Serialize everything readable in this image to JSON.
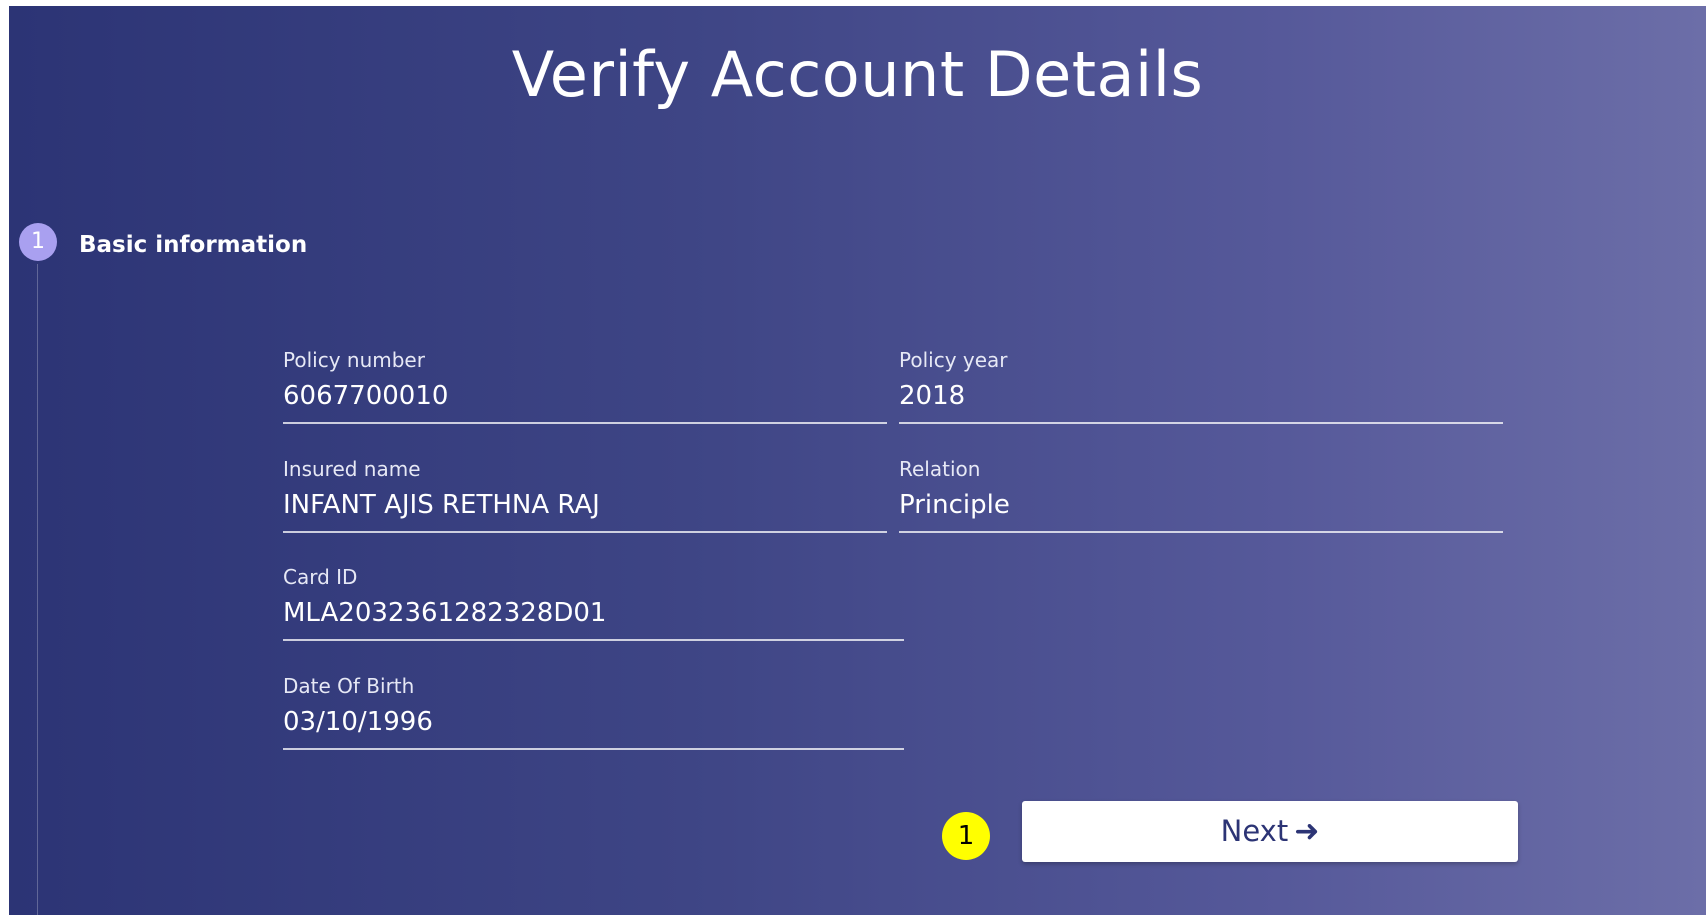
{
  "page": {
    "title": "Verify Account Details"
  },
  "steps": [
    {
      "number": "1",
      "label": "Basic information"
    }
  ],
  "fields": {
    "policy_number": {
      "label": "Policy number",
      "value": "6067700010"
    },
    "policy_year": {
      "label": "Policy year",
      "value": "2018"
    },
    "insured_name": {
      "label": "Insured name",
      "value": "INFANT AJIS RETHNA RAJ"
    },
    "relation": {
      "label": "Relation",
      "value": "Principle"
    },
    "card_id": {
      "label": "Card ID",
      "value": "MLA2032361282328D01"
    },
    "date_of_birth": {
      "label": "Date Of Birth",
      "value": "03/10/1996"
    }
  },
  "annotation": {
    "marker": "1"
  },
  "actions": {
    "next_label": "Next",
    "next_icon": "arrow-right-icon"
  },
  "colors": {
    "background_start": "#2c3475",
    "background_end": "#6c6ea8",
    "step_circle": "#a9a0f0",
    "marker": "#ffff00"
  }
}
